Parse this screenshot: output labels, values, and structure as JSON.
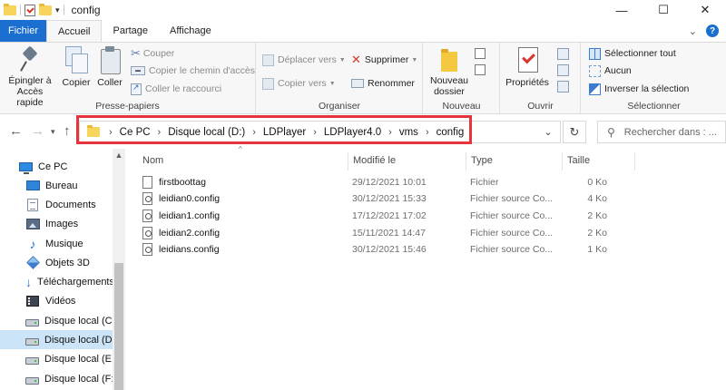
{
  "window": {
    "title": "config",
    "minimize": "—",
    "maximize": "☐",
    "close": "✕"
  },
  "ribbon_tabs": [
    {
      "label": "Fichier"
    },
    {
      "label": "Accueil"
    },
    {
      "label": "Partage"
    },
    {
      "label": "Affichage"
    }
  ],
  "ribbon": {
    "clipboard": {
      "pin_label": "Épingler à\nAccès rapide",
      "copy_label": "Copier",
      "paste_label": "Coller",
      "cut_label": "Couper",
      "copy_path_label": "Copier le chemin d'accès",
      "paste_shortcut_label": "Coller le raccourci",
      "group_label": "Presse-papiers"
    },
    "organize": {
      "move_to_label": "Déplacer vers",
      "copy_to_label": "Copier vers",
      "delete_label": "Supprimer",
      "rename_label": "Renommer",
      "group_label": "Organiser"
    },
    "new": {
      "new_folder_label": "Nouveau\ndossier",
      "group_label": "Nouveau"
    },
    "open": {
      "properties_label": "Propriétés",
      "group_label": "Ouvrir"
    },
    "select": {
      "select_all_label": "Sélectionner tout",
      "select_none_label": "Aucun",
      "invert_label": "Inverser la sélection",
      "group_label": "Sélectionner"
    }
  },
  "address": {
    "crumbs": [
      "Ce PC",
      "Disque local (D:)",
      "LDPlayer",
      "LDPlayer4.0",
      "vms",
      "config"
    ],
    "search_placeholder": "Rechercher dans : ...",
    "highlight_color": "#e7343a"
  },
  "nav_pane": {
    "items": [
      {
        "label": "Ce PC",
        "icon": "pc-icon"
      },
      {
        "label": "Bureau",
        "icon": "desktop-icon"
      },
      {
        "label": "Documents",
        "icon": "documents-icon"
      },
      {
        "label": "Images",
        "icon": "images-icon"
      },
      {
        "label": "Musique",
        "icon": "music-icon"
      },
      {
        "label": "Objets 3D",
        "icon": "objects-3d-icon"
      },
      {
        "label": "Téléchargements",
        "icon": "downloads-icon"
      },
      {
        "label": "Vidéos",
        "icon": "videos-icon"
      },
      {
        "label": "Disque local (C:)",
        "icon": "drive-icon"
      },
      {
        "label": "Disque local (D:)",
        "icon": "drive-icon",
        "selected": true
      },
      {
        "label": "Disque local (E:)",
        "icon": "drive-icon"
      },
      {
        "label": "Disque local (F:)",
        "icon": "drive-icon"
      }
    ]
  },
  "file_list": {
    "columns": {
      "name": "Nom",
      "modified": "Modifié le",
      "type": "Type",
      "size": "Taille"
    },
    "rows": [
      {
        "name": "firstboottag",
        "modified": "29/12/2021 10:01",
        "type": "Fichier",
        "size": "0 Ko",
        "icon": "file-icon"
      },
      {
        "name": "leidian0.config",
        "modified": "30/12/2021 15:33",
        "type": "Fichier source Co...",
        "size": "4 Ko",
        "icon": "config-file-icon"
      },
      {
        "name": "leidian1.config",
        "modified": "17/12/2021 17:02",
        "type": "Fichier source Co...",
        "size": "2 Ko",
        "icon": "config-file-icon"
      },
      {
        "name": "leidian2.config",
        "modified": "15/11/2021 14:47",
        "type": "Fichier source Co...",
        "size": "2 Ko",
        "icon": "config-file-icon"
      },
      {
        "name": "leidians.config",
        "modified": "30/12/2021 15:46",
        "type": "Fichier source Co...",
        "size": "1 Ko",
        "icon": "config-file-icon"
      }
    ]
  },
  "colors": {
    "file_tab": "#1a6fd0",
    "selection": "#cce4f7",
    "highlight_border": "#e7343a"
  }
}
